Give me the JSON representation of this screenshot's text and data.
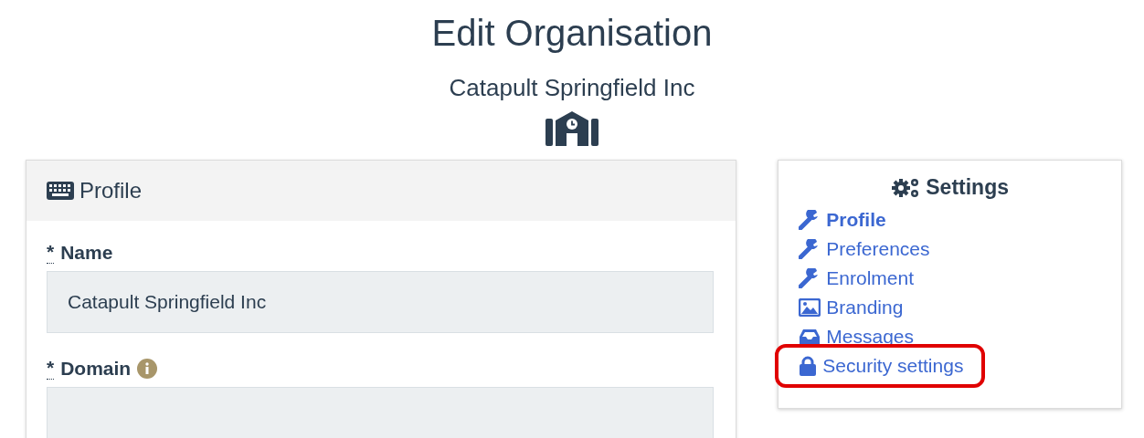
{
  "page": {
    "title": "Edit Organisation",
    "subtitle": "Catapult Springfield Inc"
  },
  "profile_card": {
    "title": "Profile",
    "fields": [
      {
        "label": "Name",
        "required_mark": "*",
        "value": "Catapult Springfield Inc",
        "info": false
      },
      {
        "label": "Domain",
        "required_mark": "*",
        "info": true
      }
    ]
  },
  "settings": {
    "title": "Settings",
    "items": [
      {
        "label": "Profile",
        "kind": "wrench",
        "selected": true,
        "highlighted": false
      },
      {
        "label": "Preferences",
        "kind": "wrench",
        "selected": false,
        "highlighted": false
      },
      {
        "label": "Enrolment",
        "kind": "wrench",
        "selected": false,
        "highlighted": false
      },
      {
        "label": "Branding",
        "kind": "image",
        "selected": false,
        "highlighted": false
      },
      {
        "label": "Messages",
        "kind": "inbox",
        "selected": false,
        "highlighted": false
      },
      {
        "label": "Security settings",
        "kind": "lock",
        "selected": false,
        "highlighted": true
      }
    ]
  }
}
